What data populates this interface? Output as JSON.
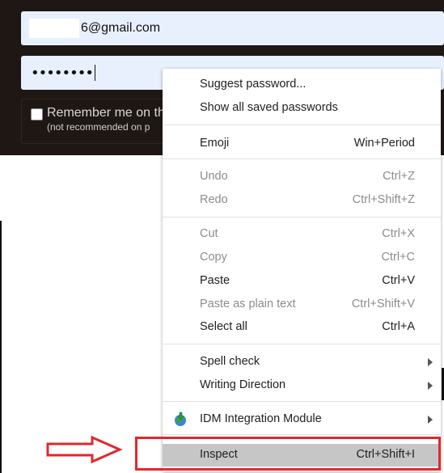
{
  "login": {
    "email_value": "6@gmail.com",
    "password_value": "••••••••",
    "remember_label": "Remember me on th",
    "remember_note": "(not recommended on p"
  },
  "context_menu": {
    "items": [
      {
        "label": "Suggest password...",
        "shortcut": "",
        "enabled": true
      },
      {
        "label": "Show all saved passwords",
        "shortcut": "",
        "enabled": true
      },
      {
        "label": "Emoji",
        "shortcut": "Win+Period",
        "enabled": true
      },
      {
        "label": "Undo",
        "shortcut": "Ctrl+Z",
        "enabled": false
      },
      {
        "label": "Redo",
        "shortcut": "Ctrl+Shift+Z",
        "enabled": false
      },
      {
        "label": "Cut",
        "shortcut": "Ctrl+X",
        "enabled": false
      },
      {
        "label": "Copy",
        "shortcut": "Ctrl+C",
        "enabled": false
      },
      {
        "label": "Paste",
        "shortcut": "Ctrl+V",
        "enabled": true
      },
      {
        "label": "Paste as plain text",
        "shortcut": "Ctrl+Shift+V",
        "enabled": false
      },
      {
        "label": "Select all",
        "shortcut": "Ctrl+A",
        "enabled": true
      },
      {
        "label": "Spell check",
        "shortcut": "",
        "enabled": true,
        "submenu": true
      },
      {
        "label": "Writing Direction",
        "shortcut": "",
        "enabled": true,
        "submenu": true
      },
      {
        "label": "IDM Integration Module",
        "shortcut": "",
        "enabled": true,
        "submenu": true,
        "icon": "idm-globe-icon"
      },
      {
        "label": "Inspect",
        "shortcut": "Ctrl+Shift+I",
        "enabled": true,
        "highlighted": true
      }
    ]
  },
  "annotation": {
    "color": "#e0282e",
    "arrow_icon": "right-arrow-icon"
  }
}
